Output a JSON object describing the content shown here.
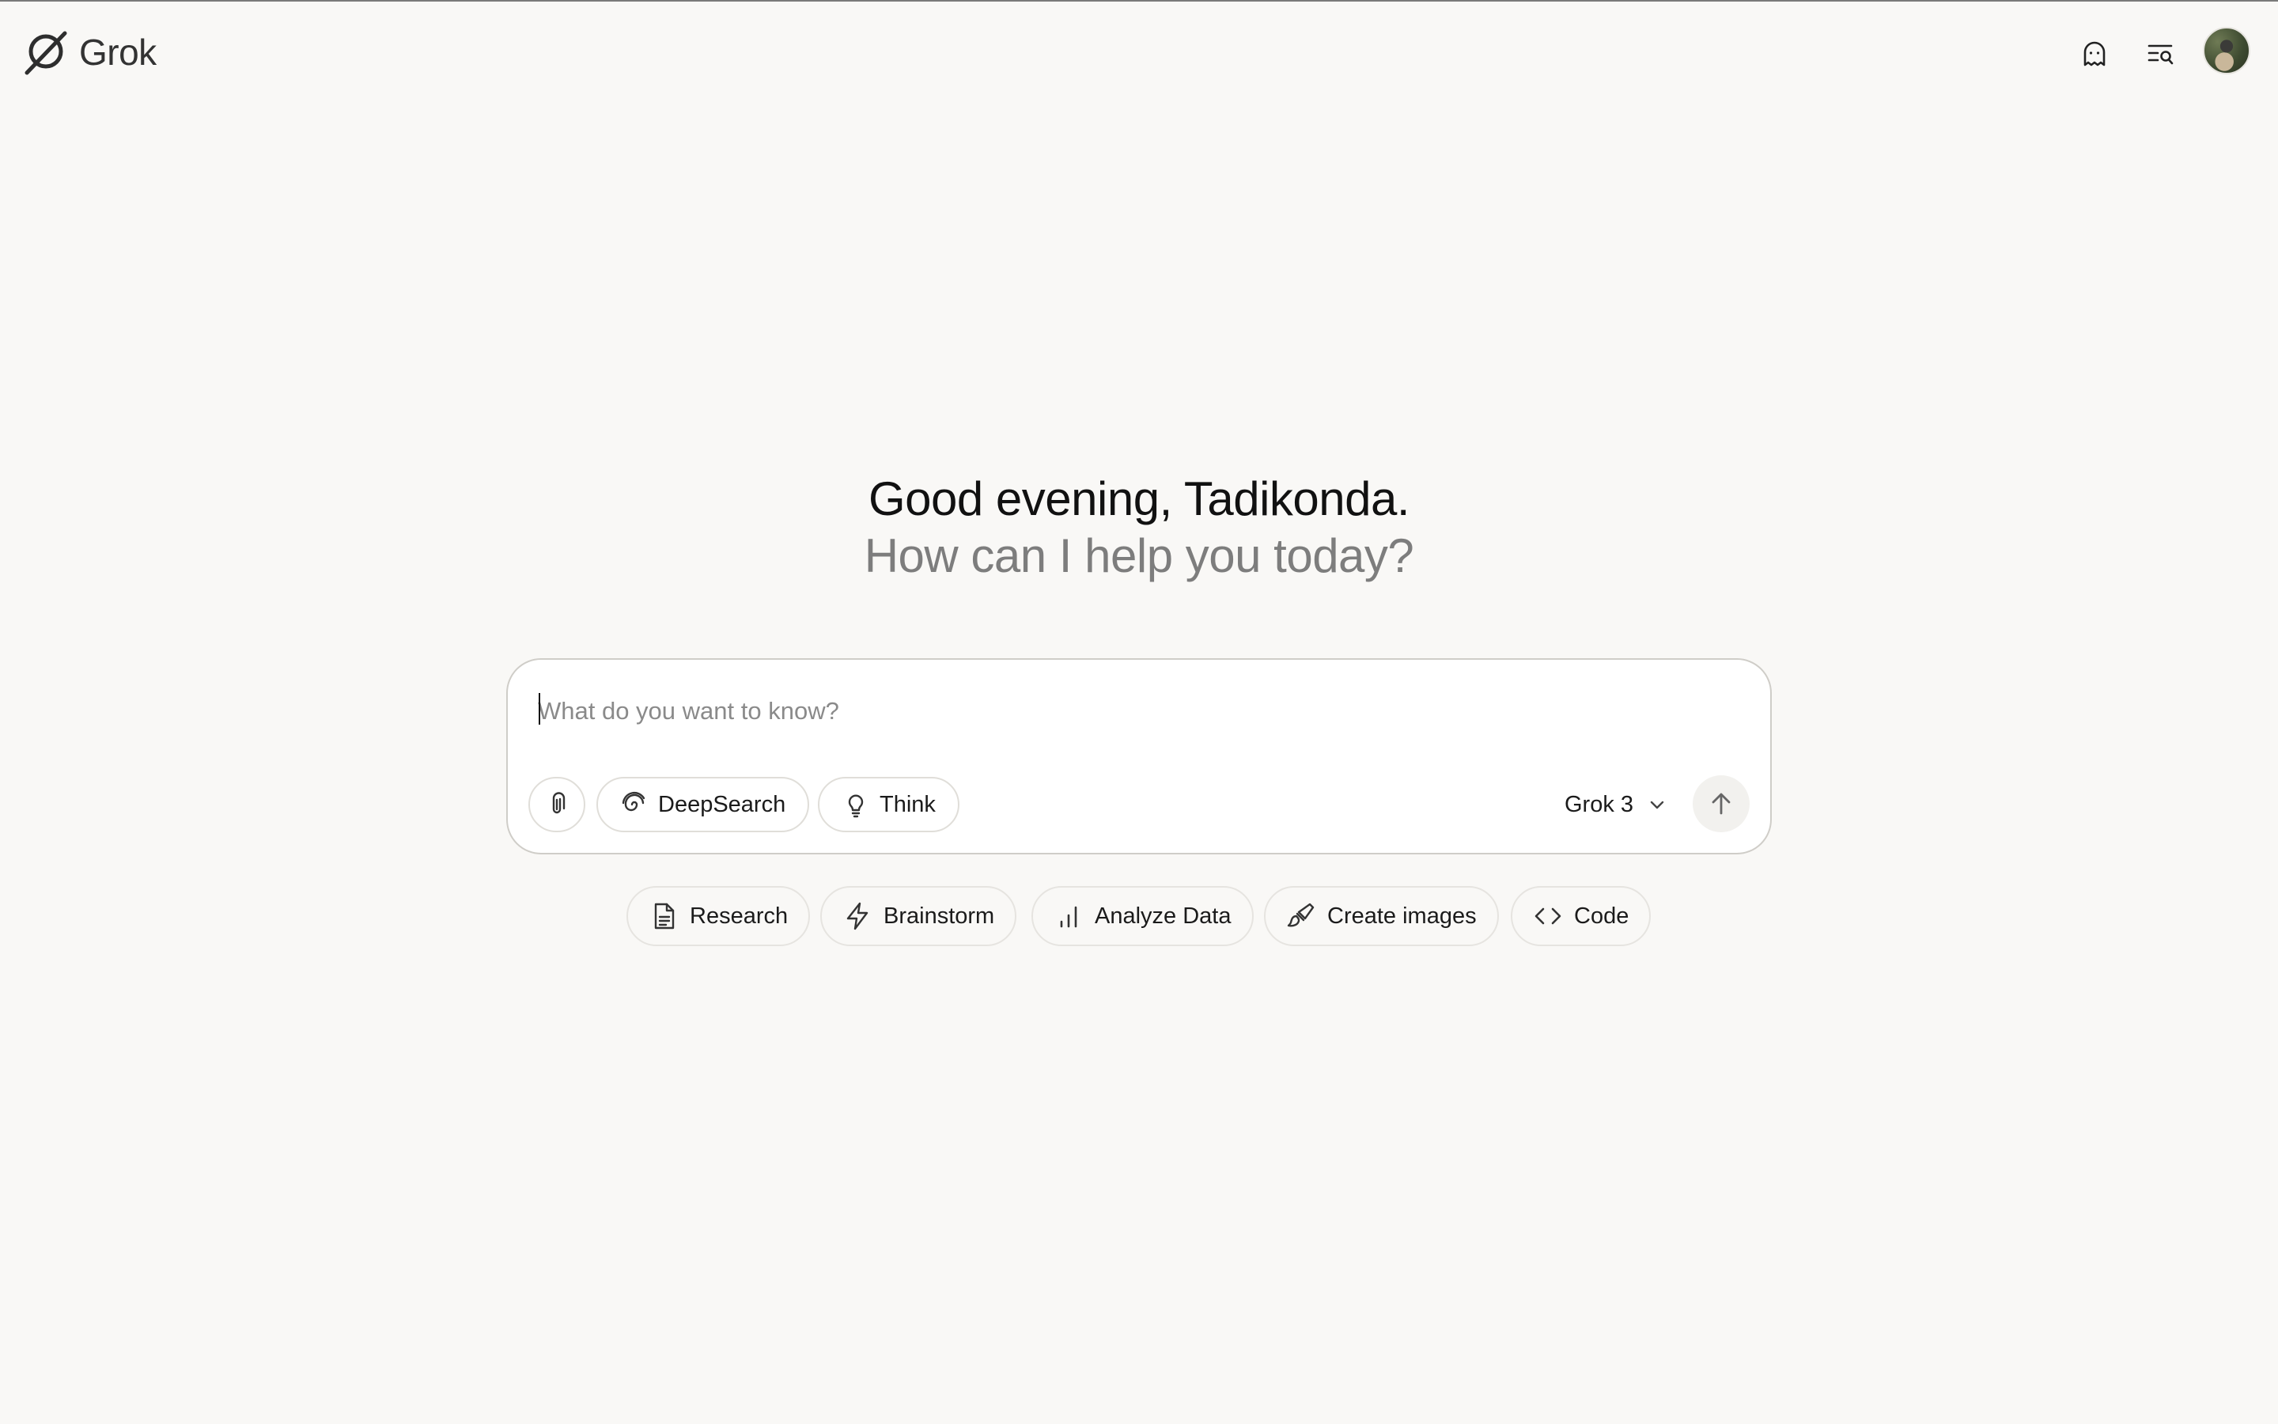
{
  "app": {
    "name": "Grok"
  },
  "header": {
    "icons": [
      "ghost-icon",
      "history-search-icon",
      "avatar"
    ]
  },
  "greeting": {
    "title": "Good evening, Tadikonda.",
    "subtitle": "How can I help you today?"
  },
  "composer": {
    "placeholder": "What do you want to know?",
    "value": "",
    "buttons": {
      "attach_icon": "paperclip-icon",
      "deepsearch": "DeepSearch",
      "think": "Think"
    },
    "model": "Grok 3",
    "send_icon": "arrow-up-icon"
  },
  "suggestions": [
    {
      "label": "Research",
      "icon": "document-icon"
    },
    {
      "label": "Brainstorm",
      "icon": "lightning-icon"
    },
    {
      "label": "Analyze Data",
      "icon": "bar-chart-icon"
    },
    {
      "label": "Create images",
      "icon": "paintbrush-icon"
    },
    {
      "label": "Code",
      "icon": "code-icon"
    }
  ],
  "colors": {
    "background": "#f9f8f6",
    "composer_border": "#cfcdc8",
    "muted_text": "#7d7d7d"
  }
}
